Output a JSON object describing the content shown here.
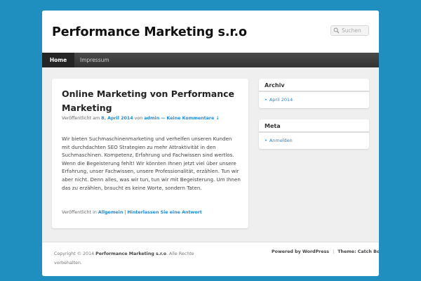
{
  "site": {
    "title": "Performance Marketing s.r.o"
  },
  "search": {
    "placeholder": "Suchen"
  },
  "nav": {
    "items": [
      {
        "label": "Home"
      },
      {
        "label": "Impressum"
      }
    ]
  },
  "post": {
    "title": "Online Marketing von Performance Marketing",
    "meta": {
      "published_prefix": "Veröffentlicht am",
      "date": "8. April 2014",
      "by": "von",
      "author": "admin",
      "separator": "—",
      "comments": "Keine Kommentare ↓"
    },
    "body": "Wir bieten Suchmaschinenmarketing und verhelfen unseren Kunden mit durchdachten SEO Strategien zu mehr Attraktivität in den Suchmaschinen. Kompetenz, Erfahrung und Fachwissen sind wertlos. Wenn die Begeisterung fehlt!   Wir könnten Ihnen jetzt viel über unsere Erfahrung, unser Fachwissen, unsere Professionalität, erzählen. Tun wir aber nicht. Denn alles, was wir tun, tun wir mit Begeisterung. Um Ihnen das zu erzählen, braucht es keine Worte, sondern Taten.",
    "footer": {
      "prefix": "Veröffentlicht in",
      "category": "Allgemein",
      "divider": "|",
      "reply": "Hinterlassen Sie eine Antwort"
    }
  },
  "sidebar": {
    "archive": {
      "title": "Archiv",
      "items": [
        "April 2014"
      ]
    },
    "meta": {
      "title": "Meta",
      "items": [
        "Anmelden"
      ]
    }
  },
  "footer": {
    "copyright_prefix": "Copyright © 2014",
    "copyright_site": "Performance Marketing s.r.o",
    "copyright_suffix": ". Alle Rechte vorbehalten.",
    "powered": "Powered by WordPress",
    "theme": "Theme: Catch Box"
  },
  "colors": {
    "background": "#1f8fc0",
    "link": "#1b8be0",
    "nav": "#333333"
  },
  "icons": {
    "search": "search-icon"
  }
}
